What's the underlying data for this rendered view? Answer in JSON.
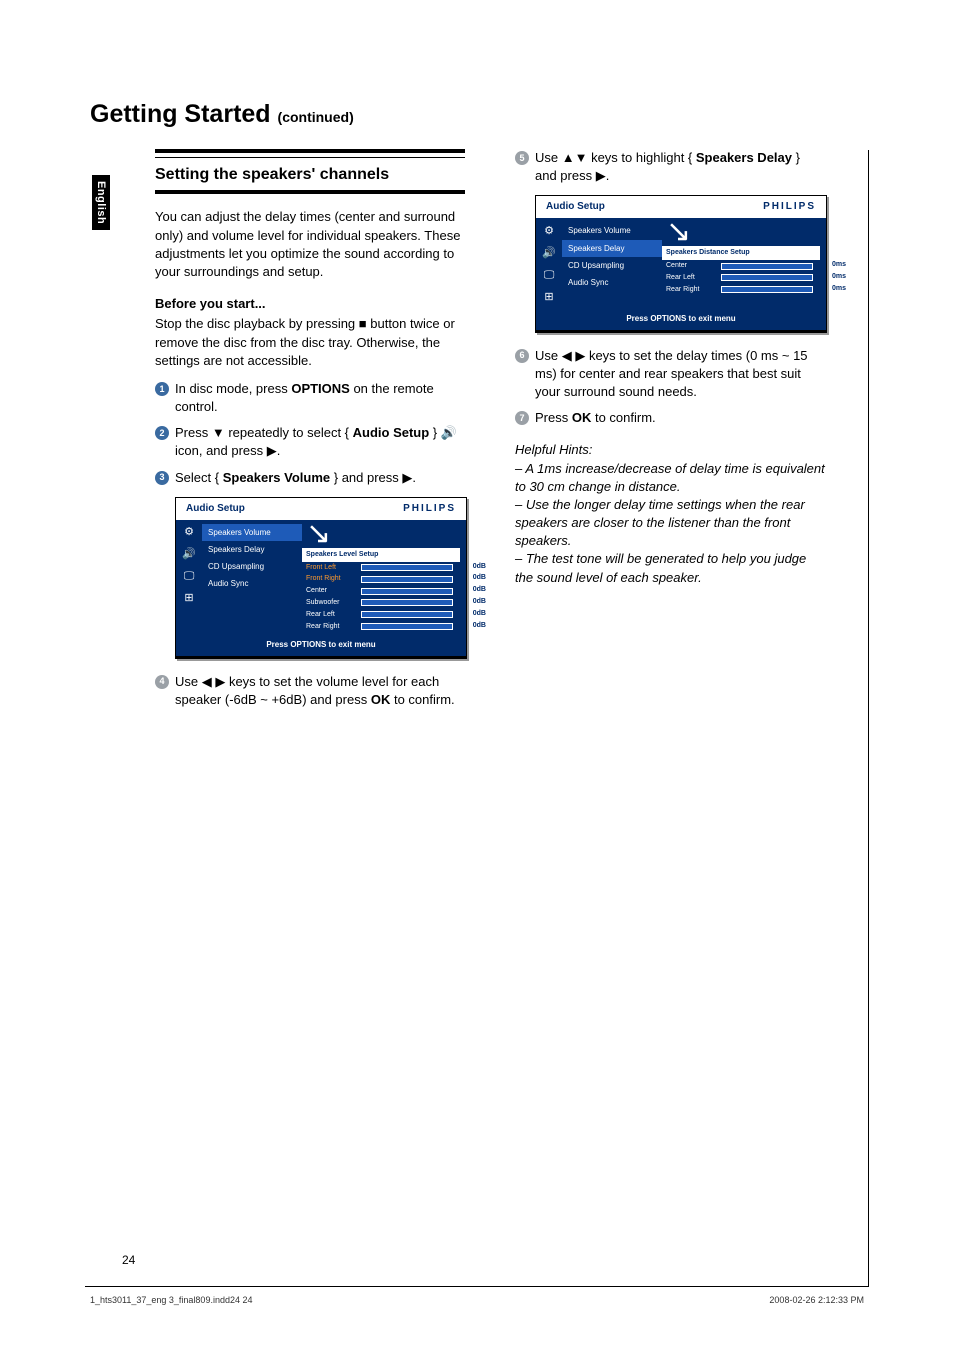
{
  "title": "Getting Started",
  "title_continued": "(continued)",
  "language_tab": "English",
  "section_heading": "Setting the speakers' channels",
  "intro_para": "You can adjust the delay times (center and surround only) and volume level for individual speakers. These adjustments let you optimize the sound according to your surroundings and setup.",
  "before_head": "Before you start...",
  "before_para": "Stop the disc playback by pressing ■ button twice or remove the disc from the disc tray. Otherwise, the settings are not accessible.",
  "steps_left": [
    {
      "n": "1",
      "pre": "In disc mode, press ",
      "bold": "OPTIONS",
      "post": " on the remote control."
    },
    {
      "n": "2",
      "text": "Press ▼ repeatedly to select { Audio Setup } 🔊 icon, and press ▶."
    },
    {
      "n": "3",
      "text": "Select { Speakers Volume } and press ▶."
    }
  ],
  "step4": {
    "n": "4",
    "pre": "Use ◀ ▶ keys to set the volume level for each speaker (-6dB ~ +6dB) and press ",
    "bold": "OK",
    "post": " to confirm."
  },
  "step5": {
    "n": "5",
    "pre": "Use ▲▼ keys to highlight { ",
    "bold": "Speakers Delay",
    "post": " } and press ▶."
  },
  "step6": {
    "n": "6",
    "text": "Use ◀ ▶ keys to set the delay times (0 ms ~ 15 ms) for center and rear speakers that best suit your surround sound needs."
  },
  "step7": {
    "n": "7",
    "pre": "Press ",
    "bold": "OK",
    "post": " to confirm."
  },
  "hints_head": "Helpful Hints:",
  "hints": [
    "– A 1ms increase/decrease of delay time is equivalent to 30 cm change in distance.",
    "– Use the longer delay time settings when the rear speakers are closer to the listener than the front speakers.",
    "– The test tone will be generated to help you judge the sound level of each speaker."
  ],
  "osd_common": {
    "header": "Audio Setup",
    "brand": "PHILIPS",
    "menu": [
      "Speakers Volume",
      "Speakers Delay",
      "CD Upsampling",
      "Audio Sync"
    ],
    "footer": "Press OPTIONS to exit menu"
  },
  "osd1": {
    "highlight_index": 0,
    "subhead": "Speakers Level Setup",
    "rows": [
      {
        "label": "Front Left",
        "val": "0dB",
        "orange": true
      },
      {
        "label": "Front Right",
        "val": "0dB",
        "orange": true
      },
      {
        "label": "Center",
        "val": "0dB"
      },
      {
        "label": "Subwoofer",
        "val": "0dB"
      },
      {
        "label": "Rear Left",
        "val": "0dB"
      },
      {
        "label": "Rear Right",
        "val": "0dB"
      }
    ]
  },
  "osd2": {
    "highlight_index": 1,
    "subhead": "Speakers Distance Setup",
    "rows": [
      {
        "label": "Center",
        "val": "0ms"
      },
      {
        "label": "Rear Left",
        "val": "0ms"
      },
      {
        "label": "Rear Right",
        "val": "0ms"
      }
    ]
  },
  "page_number": "24",
  "footer_left": "1_hts3011_37_eng 3_final809.indd24   24",
  "footer_right": "2008-02-26   2:12:33 PM"
}
